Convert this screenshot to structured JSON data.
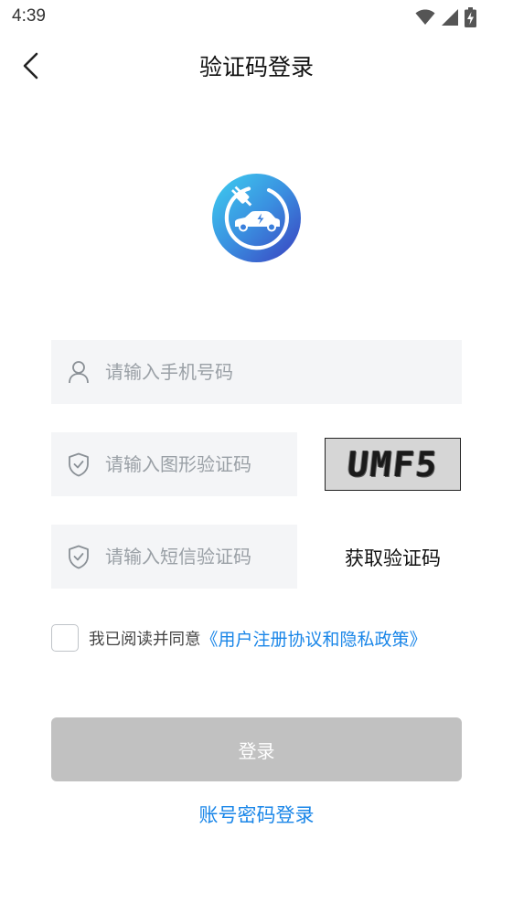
{
  "status_bar": {
    "time": "4:39",
    "icons": [
      "wifi-icon",
      "signal-icon",
      "battery-charging-icon"
    ]
  },
  "header": {
    "title": "验证码登录",
    "back_icon": "chevron-left-icon"
  },
  "logo": {
    "icon": "ev-charging-car-logo",
    "colors": {
      "gradient_start": "#38c6ee",
      "gradient_end": "#3b4fc4"
    }
  },
  "form": {
    "phone": {
      "placeholder": "请输入手机号码",
      "value": "",
      "icon": "user-icon"
    },
    "image_code": {
      "placeholder": "请输入图形验证码",
      "value": "",
      "icon": "shield-check-icon",
      "captcha_text": "UMF5"
    },
    "sms_code": {
      "placeholder": "请输入短信验证码",
      "value": "",
      "icon": "shield-check-icon",
      "get_code_label": "获取验证码"
    }
  },
  "agreement": {
    "checked": false,
    "text": "我已阅读并同意",
    "link_text": "《用户注册协议和隐私政策》"
  },
  "actions": {
    "login_label": "登录",
    "password_login_label": "账号密码登录"
  },
  "colors": {
    "accent": "#1a86e8",
    "input_bg": "#f4f5f7",
    "login_disabled_bg": "#c1c1c1",
    "placeholder": "#9aa0a6"
  }
}
